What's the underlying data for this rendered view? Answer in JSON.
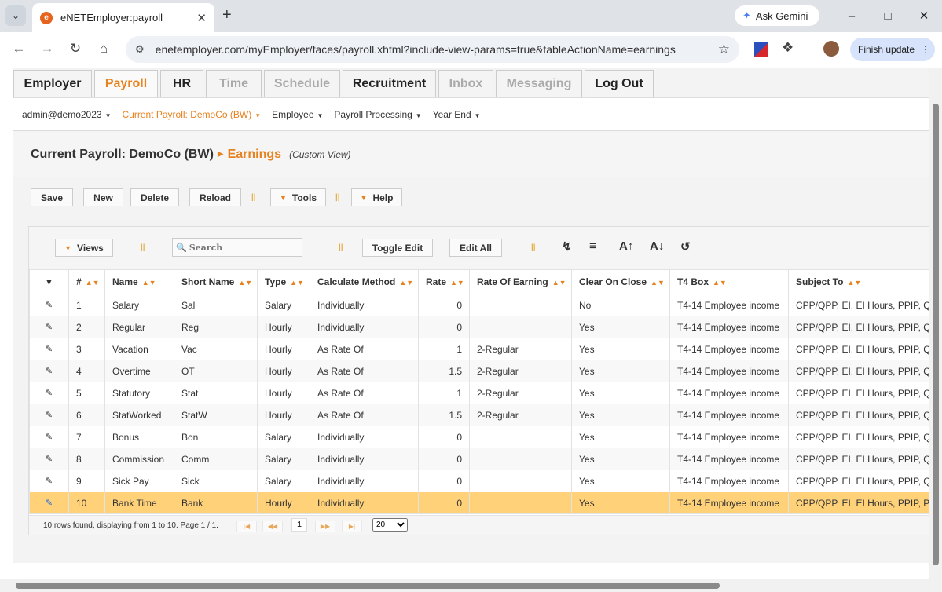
{
  "browser": {
    "tab_title": "eNETEmployer:payroll",
    "favicon_letter": "e",
    "gemini_label": "Ask Gemini",
    "url": "enetemployer.com/myEmployer/faces/payroll.xhtml?include-view-params=true&tableActionName=earnings",
    "finish_update_label": "Finish update"
  },
  "main_tabs": [
    {
      "label": "Employer",
      "state": "normal"
    },
    {
      "label": "Payroll",
      "state": "active"
    },
    {
      "label": "HR",
      "state": "normal"
    },
    {
      "label": "Time",
      "state": "disabled"
    },
    {
      "label": "Schedule",
      "state": "disabled"
    },
    {
      "label": "Recruitment",
      "state": "normal"
    },
    {
      "label": "Inbox",
      "state": "disabled"
    },
    {
      "label": "Messaging",
      "state": "disabled"
    },
    {
      "label": "Log Out",
      "state": "normal"
    }
  ],
  "menubar": {
    "user": "admin@demo2023",
    "current_payroll": "Current Payroll: DemoCo (BW)",
    "employee": "Employee",
    "payroll_processing": "Payroll Processing",
    "year_end": "Year End"
  },
  "breadcrumb": {
    "main": "Current Payroll: DemoCo (BW)",
    "sub": "Earnings",
    "view": "(Custom View)"
  },
  "actions": {
    "save": "Save",
    "new": "New",
    "delete": "Delete",
    "reload": "Reload",
    "tools": "Tools",
    "help": "Help"
  },
  "grid_toolbar": {
    "views": "Views",
    "search_placeholder": "Search",
    "toggle_edit": "Toggle Edit",
    "edit_all": "Edit All",
    "font_increase": "A",
    "font_decrease": "A"
  },
  "columns": [
    "#",
    "Name",
    "Short Name",
    "Type",
    "Calculate Method",
    "Rate",
    "Rate Of Earning",
    "Clear On Close",
    "T4 Box",
    "Subject To"
  ],
  "rows": [
    {
      "num": "1",
      "name": "Salary",
      "short": "Sal",
      "type": "Salary",
      "method": "Individually",
      "rate": "0",
      "rate_of": "",
      "clear": "No",
      "t4": "T4-14 Employee income",
      "subject": "CPP/QPP, EI, EI Hours, PPIP, Q"
    },
    {
      "num": "2",
      "name": "Regular",
      "short": "Reg",
      "type": "Hourly",
      "method": "Individually",
      "rate": "0",
      "rate_of": "",
      "clear": "Yes",
      "t4": "T4-14 Employee income",
      "subject": "CPP/QPP, EI, EI Hours, PPIP, Q"
    },
    {
      "num": "3",
      "name": "Vacation",
      "short": "Vac",
      "type": "Hourly",
      "method": "As Rate Of",
      "rate": "1",
      "rate_of": "2-Regular",
      "clear": "Yes",
      "t4": "T4-14 Employee income",
      "subject": "CPP/QPP, EI, EI Hours, PPIP, Q"
    },
    {
      "num": "4",
      "name": "Overtime",
      "short": "OT",
      "type": "Hourly",
      "method": "As Rate Of",
      "rate": "1.5",
      "rate_of": "2-Regular",
      "clear": "Yes",
      "t4": "T4-14 Employee income",
      "subject": "CPP/QPP, EI, EI Hours, PPIP, Q"
    },
    {
      "num": "5",
      "name": "Statutory",
      "short": "Stat",
      "type": "Hourly",
      "method": "As Rate Of",
      "rate": "1",
      "rate_of": "2-Regular",
      "clear": "Yes",
      "t4": "T4-14 Employee income",
      "subject": "CPP/QPP, EI, EI Hours, PPIP, Q"
    },
    {
      "num": "6",
      "name": "StatWorked",
      "short": "StatW",
      "type": "Hourly",
      "method": "As Rate Of",
      "rate": "1.5",
      "rate_of": "2-Regular",
      "clear": "Yes",
      "t4": "T4-14 Employee income",
      "subject": "CPP/QPP, EI, EI Hours, PPIP, Q"
    },
    {
      "num": "7",
      "name": "Bonus",
      "short": "Bon",
      "type": "Salary",
      "method": "Individually",
      "rate": "0",
      "rate_of": "",
      "clear": "Yes",
      "t4": "T4-14 Employee income",
      "subject": "CPP/QPP, EI, EI Hours, PPIP, Q"
    },
    {
      "num": "8",
      "name": "Commission",
      "short": "Comm",
      "type": "Salary",
      "method": "Individually",
      "rate": "0",
      "rate_of": "",
      "clear": "Yes",
      "t4": "T4-14 Employee income",
      "subject": "CPP/QPP, EI, EI Hours, PPIP, Q"
    },
    {
      "num": "9",
      "name": "Sick Pay",
      "short": "Sick",
      "type": "Salary",
      "method": "Individually",
      "rate": "0",
      "rate_of": "",
      "clear": "Yes",
      "t4": "T4-14 Employee income",
      "subject": "CPP/QPP, EI, EI Hours, PPIP, Q"
    },
    {
      "num": "10",
      "name": "Bank Time",
      "short": "Bank",
      "type": "Hourly",
      "method": "Individually",
      "rate": "0",
      "rate_of": "",
      "clear": "Yes",
      "t4": "T4-14 Employee income",
      "subject": "CPP/QPP, EI, EI Hours, PPIP, P"
    }
  ],
  "selected_row": 9,
  "pager": {
    "info": "10 rows found, displaying from 1 to 10. Page 1 / 1.",
    "current_page": "1",
    "page_size": "20",
    "page_size_options": [
      "20"
    ]
  },
  "colors": {
    "accent": "#e8821e",
    "selected_row": "#ffd27a"
  }
}
